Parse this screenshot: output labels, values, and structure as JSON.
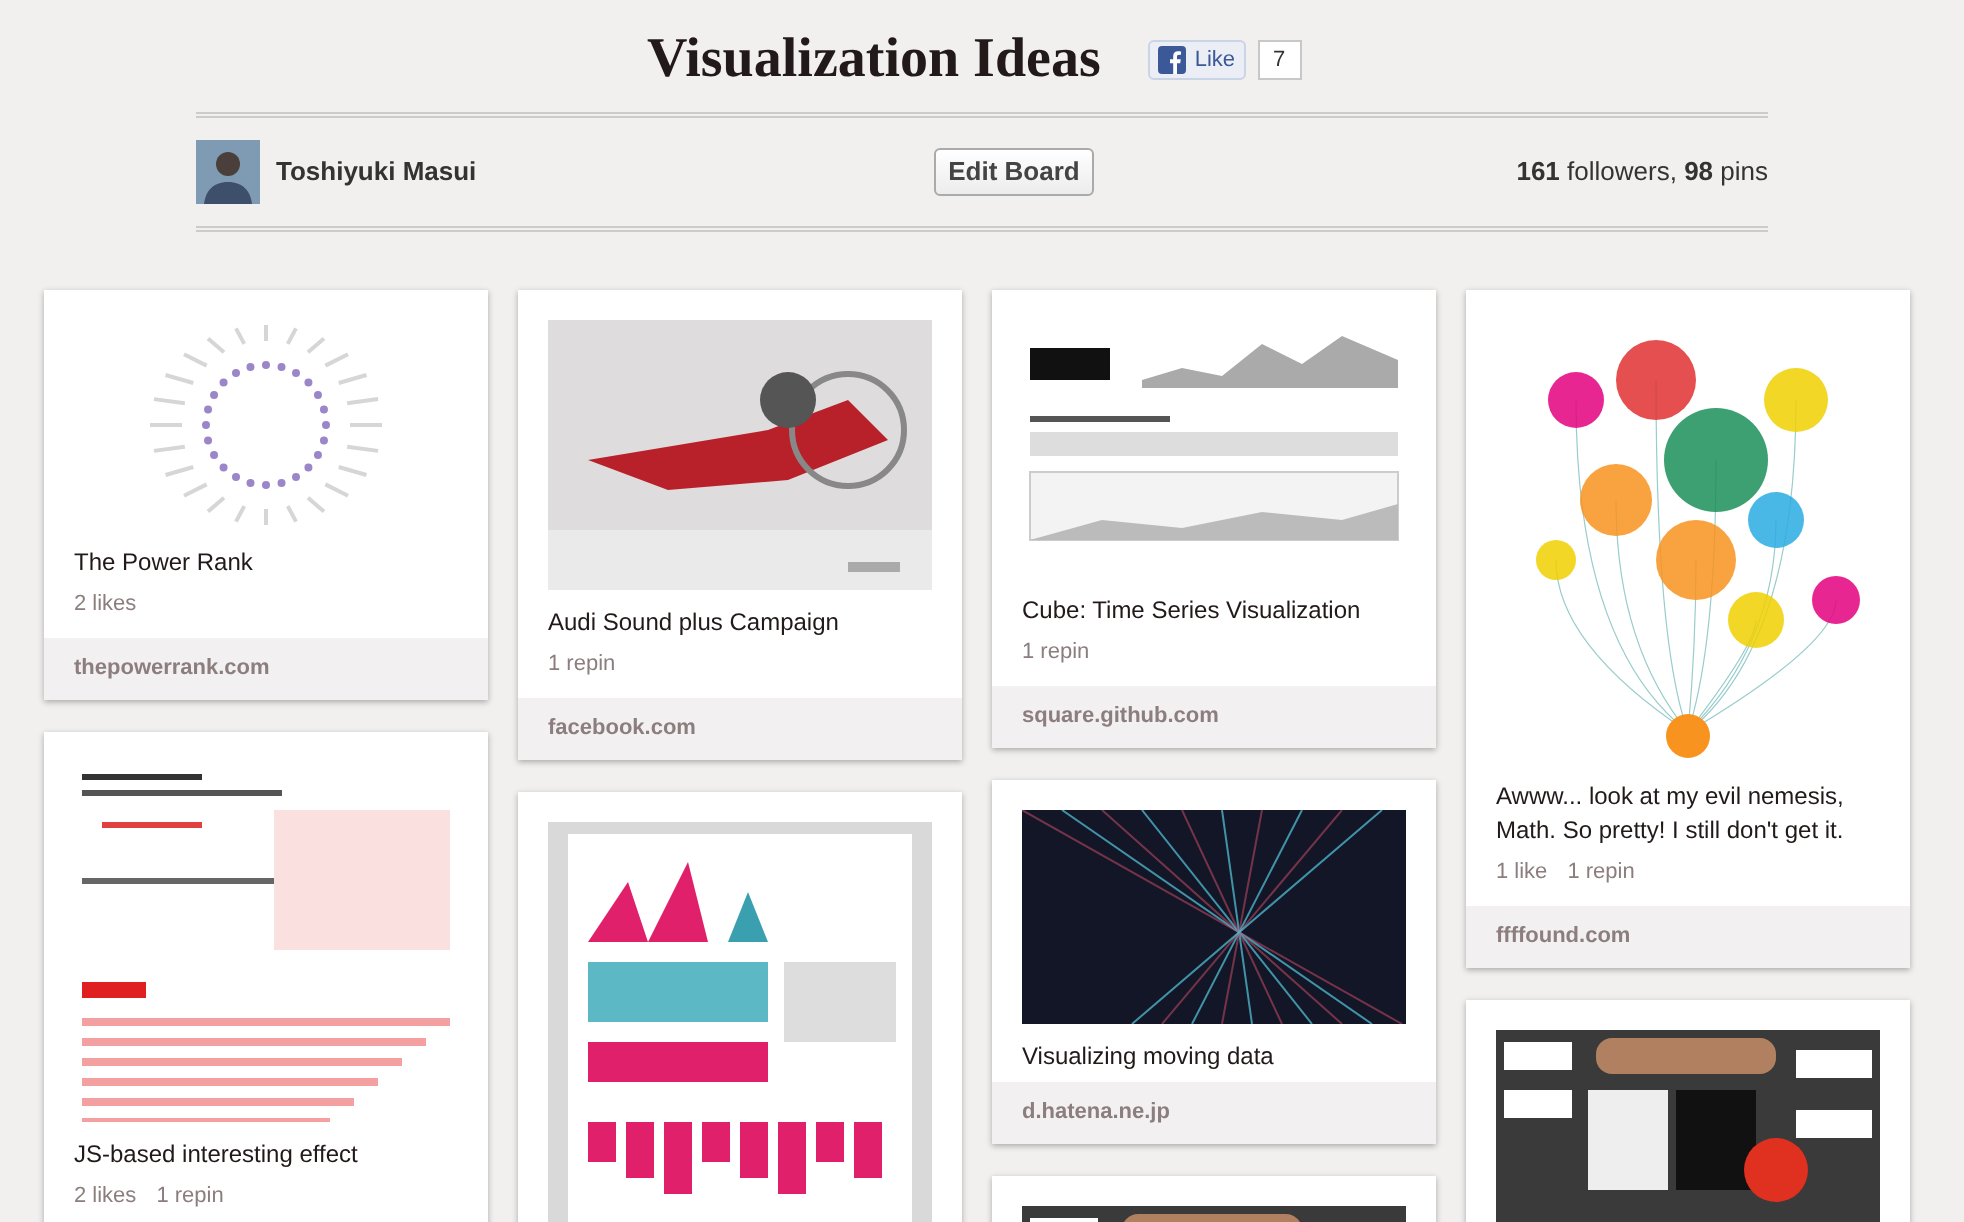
{
  "board": {
    "title": "Visualization Ideas",
    "like_label": "Like",
    "like_count": "7"
  },
  "owner": {
    "name": "Toshiyuki Masui"
  },
  "edit_button": "Edit Board",
  "stats": "**161** followers, **98** pins",
  "columns": [
    [
      {
        "title": "The Power Rank",
        "stats": [
          "2 likes"
        ],
        "source": "thepowerrank.com"
      },
      {
        "title": "JS-based interesting effect",
        "stats": [
          "2 likes",
          "1 repin"
        ]
      }
    ],
    [
      {
        "title": "Audi Sound plus Campaign",
        "stats": [
          "1 repin"
        ],
        "source": "facebook.com"
      },
      {}
    ],
    [
      {
        "title": "Cube: Time Series Visualization",
        "stats": [
          "1 repin"
        ],
        "source": "square.github.com"
      },
      {
        "title": "Visualizing moving data",
        "source": "d.hatena.ne.jp"
      },
      {}
    ],
    [
      {
        "title": "Awww... look at my evil nemesis, Math. So pretty! I still don't get it.",
        "stats": [
          "1 like",
          "1 repin"
        ],
        "source": "ffffound.com"
      },
      {}
    ]
  ]
}
